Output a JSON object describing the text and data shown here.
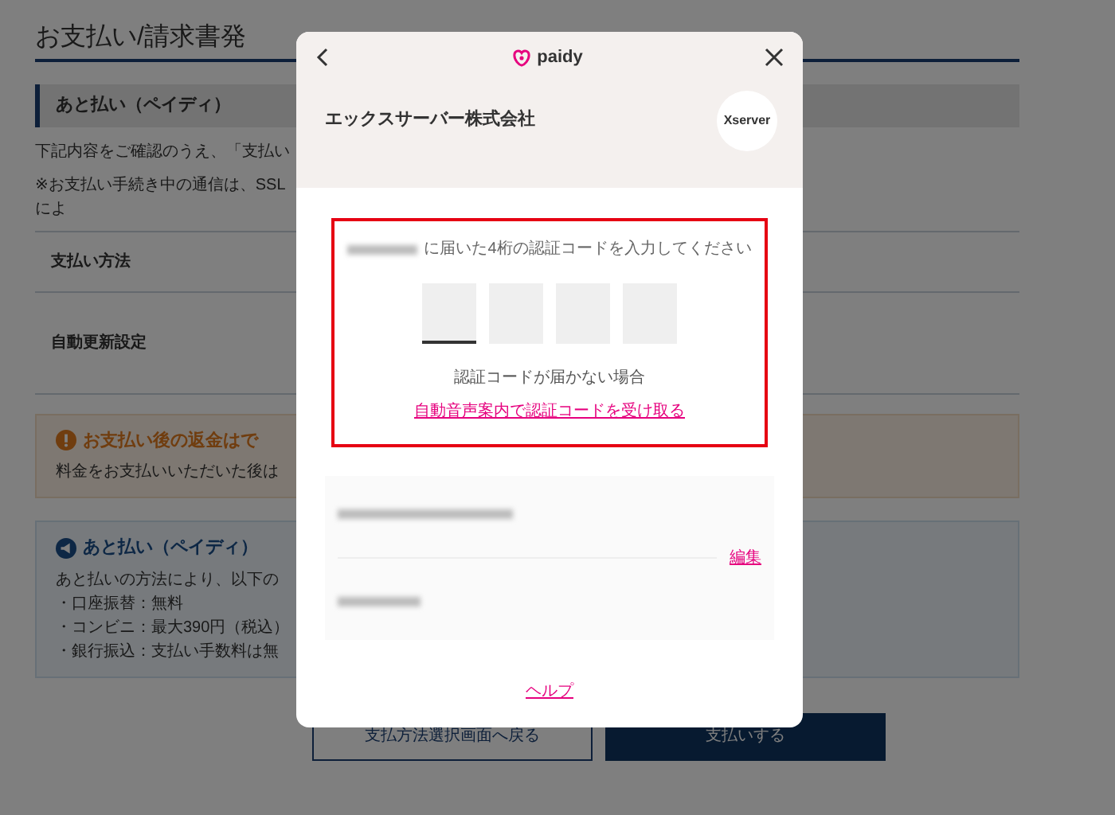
{
  "page": {
    "title": "お支払い/請求書発",
    "section_header": "あと払い（ペイディ）",
    "intro": "下記内容をご確認のうえ、「支払い",
    "ssl_note": "※お支払い手続き中の通信は、SSLによ",
    "rows": [
      {
        "label": "支払い方法"
      },
      {
        "label": "自動更新設定"
      }
    ],
    "notice_boxes": [
      {
        "kind": "warning",
        "title": "お支払い後の返金はで",
        "lines": [
          "料金をお支払いいただいた後は"
        ]
      },
      {
        "kind": "info",
        "title": "あと払い（ペイディ）",
        "lines": [
          "あと払いの方法により、以下の",
          "・口座振替：無料",
          "・コンビニ：最大390円（税込）",
          "・銀行振込：支払い手数料は無"
        ]
      }
    ],
    "buttons": [
      {
        "kind": "secondary",
        "label": "支払方法選択画面へ戻る"
      },
      {
        "kind": "primary",
        "label": "支払いする"
      }
    ]
  },
  "dialog": {
    "brand": "paidy",
    "merchant": "エックスサーバー株式会社",
    "merchant_logo": "Xserver",
    "prompt": "に届いた4桁の認証コードを入力してください",
    "code_digits": [
      {
        "focused": true
      },
      {
        "focused": false
      },
      {
        "focused": false
      },
      {
        "focused": false
      }
    ],
    "no_code_text": "認証コードが届かない場合",
    "voice_link": "自動音声案内で認証コードを受け取る",
    "edit_link": "編集",
    "help_link": "ヘルプ"
  }
}
